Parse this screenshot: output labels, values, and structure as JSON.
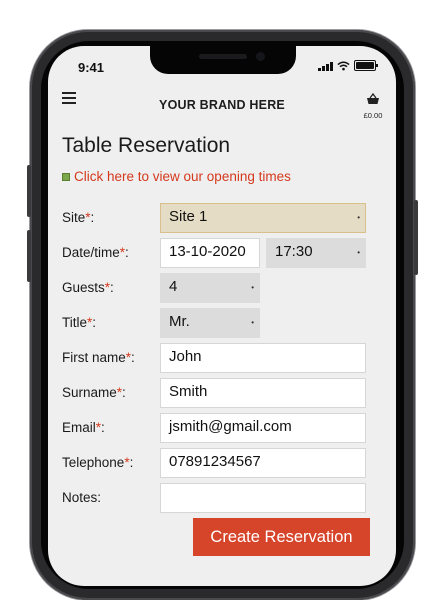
{
  "status": {
    "time": "9:41"
  },
  "header": {
    "brand": "YOUR BRAND HERE",
    "basket_price": "£0.00"
  },
  "page": {
    "title": "Table Reservation",
    "opening_link": "Click here to view our opening times"
  },
  "form": {
    "site": {
      "label": "Site",
      "required_mark": "*",
      "suffix": ":",
      "value": "Site 1"
    },
    "datetime": {
      "label": "Date/time",
      "required_mark": "*",
      "suffix": ":",
      "date": "13-10-2020",
      "time": "17:30"
    },
    "guests": {
      "label": "Guests",
      "required_mark": "*",
      "suffix": ":",
      "value": "4"
    },
    "title": {
      "label": "Title",
      "required_mark": "*",
      "suffix": ":",
      "value": "Mr."
    },
    "first_name": {
      "label": "First name",
      "required_mark": "*",
      "suffix": ":",
      "value": "John"
    },
    "surname": {
      "label": "Surname",
      "required_mark": "*",
      "suffix": ":",
      "value": "Smith"
    },
    "email": {
      "label": "Email",
      "required_mark": "*",
      "suffix": ":",
      "value": "jsmith@gmail.com"
    },
    "telephone": {
      "label": "Telephone",
      "required_mark": "*",
      "suffix": ":",
      "value": "07891234567"
    },
    "notes": {
      "label": "Notes:",
      "value": ""
    },
    "submit_label": "Create Reservation"
  },
  "icons": {
    "menu": "hamburger-icon",
    "basket": "basket-icon",
    "dropdown": "dropdown-dot-icon",
    "opening": "calendar-icon"
  },
  "colors": {
    "accent": "#d6442a",
    "required": "#d4391c",
    "link": "#d4391c",
    "site_field": "#e5dcc6",
    "select_field": "#dcdcdc",
    "screen_bg": "#efefef"
  }
}
